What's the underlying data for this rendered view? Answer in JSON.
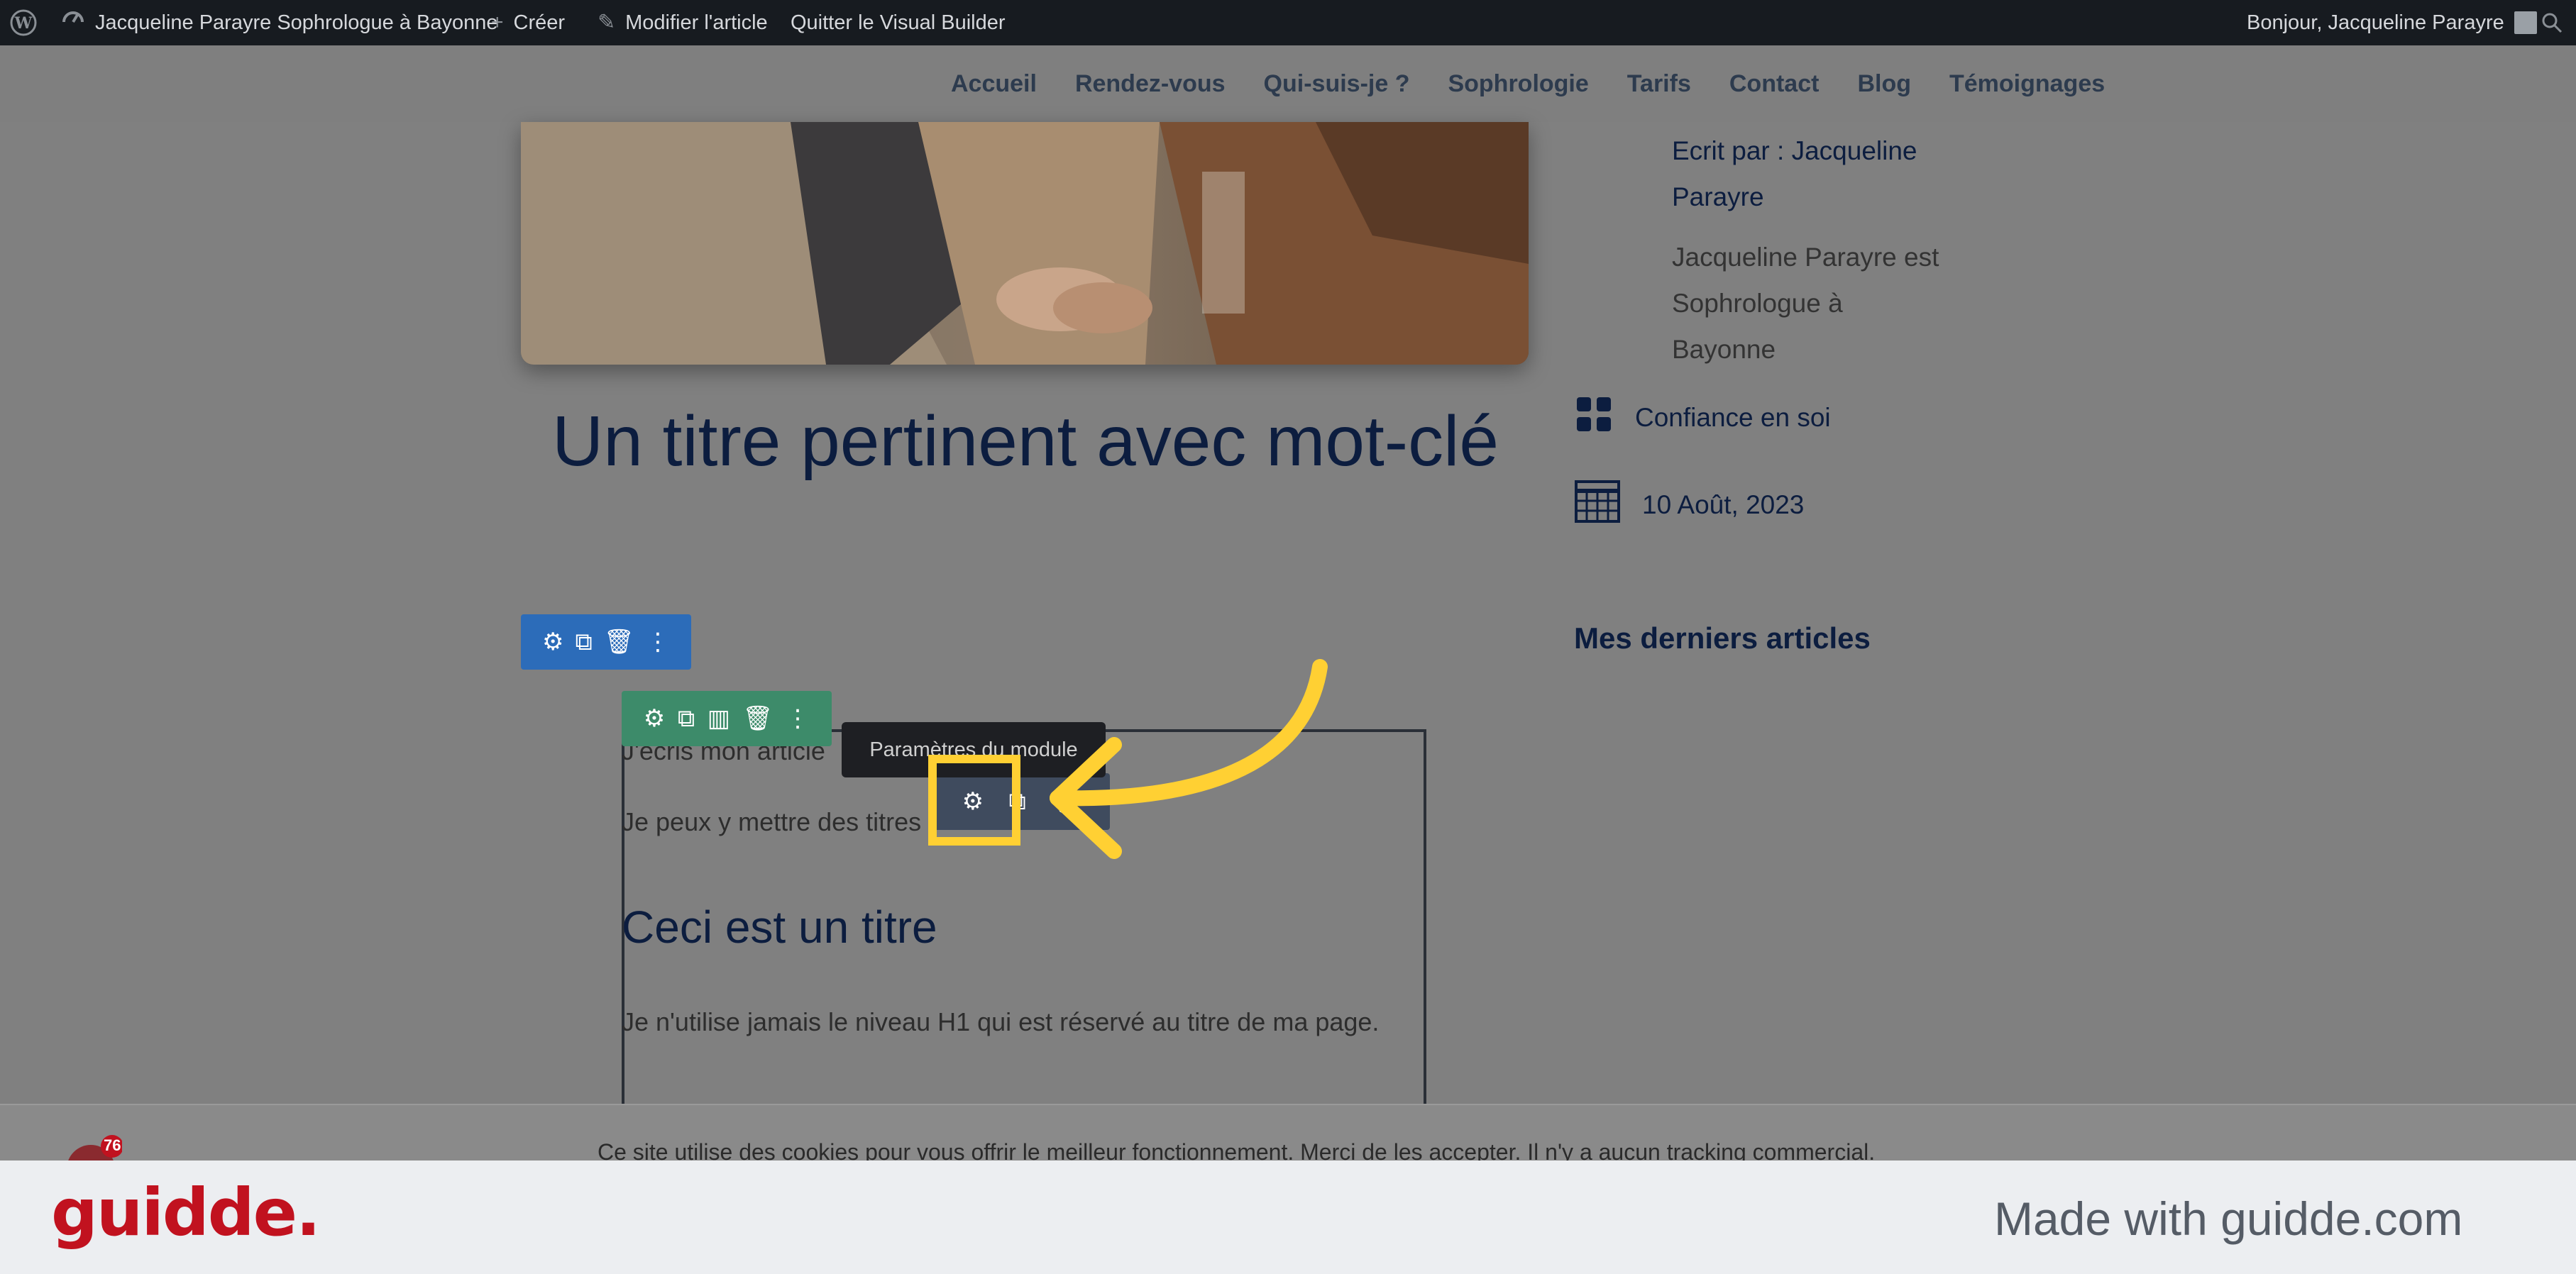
{
  "admin_bar": {
    "site_name": "Jacqueline Parayre Sophrologue à Bayonne",
    "create": "Créer",
    "edit_post": "Modifier l'article",
    "exit_builder": "Quitter le Visual Builder",
    "greeting": "Bonjour, Jacqueline Parayre"
  },
  "nav": {
    "items": [
      "Accueil",
      "Rendez-vous",
      "Qui-suis-je ?",
      "Sophrologie",
      "Tarifs",
      "Contact",
      "Blog",
      "Témoignages"
    ]
  },
  "post": {
    "title": "Un titre pertinent avec mot-clé",
    "para1": "J'écris mon article",
    "para2": "Je peux y mettre des titres",
    "heading": "Ceci est un titre",
    "para3": "Je n'utilise jamais le niveau H1 qui est réservé au titre de ma page."
  },
  "sidebar": {
    "author_line1": "Ecrit par : Jacqueline",
    "author_line2": "Parayre",
    "bio_line1": "Jacqueline Parayre est",
    "bio_line2": "Sophrologue à",
    "bio_line3": "Bayonne",
    "category": "Confiance en soi",
    "date": "10 Août, 2023",
    "recent_title": "Mes derniers articles"
  },
  "builder": {
    "tooltip": "Paramètres du module"
  },
  "cookie": {
    "text": "Ce site utilise des cookies pour vous offrir le meilleur fonctionnement. Merci de les accepter. Il n'y a aucun tracking commercial.",
    "badge_count": "76"
  },
  "footer": {
    "brand": "guidde.",
    "made_with": "Made with guidde.com"
  },
  "colors": {
    "admin_bg": "#171b20",
    "title_navy": "#0c1d3f",
    "section_blue": "#2c6cb9",
    "row_green": "#3d8b6a",
    "module_gray": "#3f4b5e",
    "highlight_yellow": "#ffd033",
    "brand_red": "#c1121f"
  }
}
